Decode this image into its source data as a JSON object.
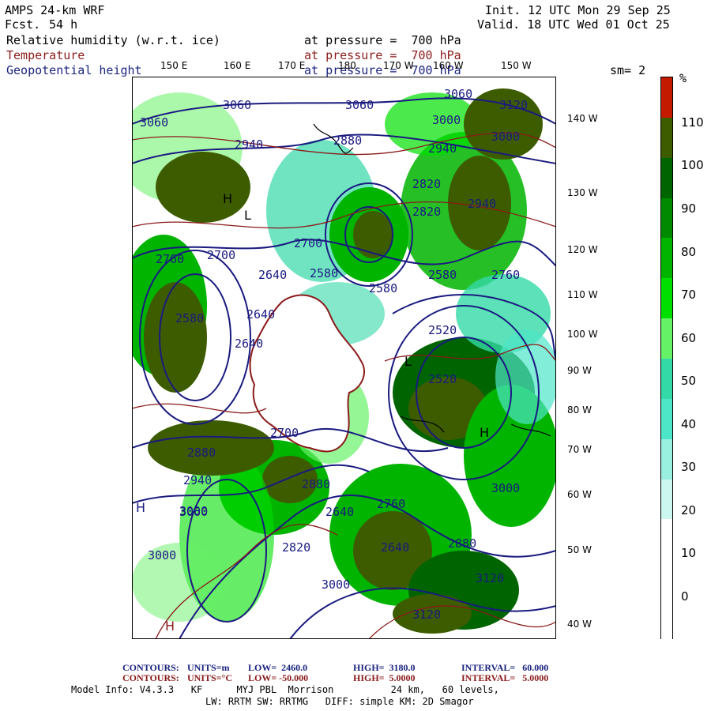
{
  "header": {
    "model": "AMPS 24-km WRF",
    "fcst_label": "Fcst.",
    "fcst_value": "54 h",
    "init": "Init. 12 UTC Mon 29 Sep 25",
    "valid": "Valid. 18 UTC Wed 01 Oct 25"
  },
  "fields": [
    {
      "name": "Relative humidity (w.r.t. ice)",
      "level": "at pressure =  700 hPa",
      "color": "#000000"
    },
    {
      "name": "Temperature",
      "level": "at pressure =  700 hPa",
      "color": "#8b1a1a"
    },
    {
      "name": "Geopotential height",
      "level": "at pressure =  700 hPa",
      "color": "#1a237e"
    }
  ],
  "smoothing": "sm= 2",
  "map": {
    "lon_labels": [
      "150 E",
      "160 E",
      "170 E",
      "180",
      "170 W",
      "160 W",
      "150 W"
    ],
    "lat_labels": [
      "140 W",
      "130 W",
      "120 W",
      "110 W",
      "100 W",
      "90 W",
      "80 W",
      "70 W",
      "60 W",
      "50 W",
      "40 W"
    ],
    "height_labels": [
      "3060",
      "3060",
      "3060",
      "3060",
      "3120",
      "3000",
      "2940",
      "3000",
      "2940",
      "2880",
      "2820",
      "2820",
      "2940",
      "2760",
      "2700",
      "2700",
      "2640",
      "2580",
      "2580",
      "2640",
      "2640",
      "2580",
      "2520",
      "2580",
      "2760",
      "2520",
      "2700",
      "2880",
      "2940",
      "3060",
      "3000",
      "3000",
      "2880",
      "2820",
      "2640",
      "2760",
      "2640",
      "3000",
      "2880",
      "3000",
      "3120",
      "3120"
    ],
    "marks": [
      "H",
      "L",
      "H",
      "H",
      "L",
      "H"
    ],
    "colors": {
      "heights": "#1a1a80",
      "temperature": "#8b1a1a",
      "coastline": "#000000"
    }
  },
  "colorbar": {
    "unit": "%",
    "labels": [
      "110",
      "100",
      "90",
      "80",
      "70",
      "60",
      "50",
      "40",
      "30",
      "20",
      "10",
      "0"
    ],
    "colors": [
      "#c41a00",
      "#3d5c00",
      "#006400",
      "#008a00",
      "#00b400",
      "#00e000",
      "#66f266",
      "#33d9a6",
      "#4de6c8",
      "#99f0e0",
      "#ccf7f0",
      "#ffffff",
      "#ffffff",
      "#ffffff"
    ]
  },
  "footer": {
    "contours1": {
      "label": "CONTOURS:",
      "units": "UNITS=m",
      "low": "LOW=  2460.0",
      "high": "HIGH=  3180.0",
      "interval": "INTERVAL=   60.000",
      "color": "#1a237e"
    },
    "contours2": {
      "label": "CONTOURS:",
      "units": "UNITS=°C",
      "low": "LOW= -50.000",
      "high": "HIGH=  5.0000",
      "interval": "INTERVAL=   5.0000",
      "color": "#8b1a1a"
    },
    "info1": "Model Info: V4.3.3   KF      MYJ PBL  Morrison          24 km,   60 levels,",
    "info2": "LW: RRTM SW: RRTMG   DIFF: simple KM: 2D Smagor"
  }
}
